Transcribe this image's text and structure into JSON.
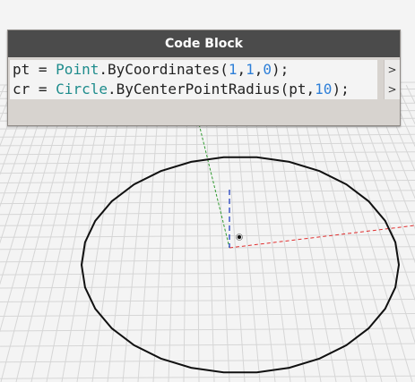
{
  "node": {
    "title": "Code Block",
    "lines": [
      {
        "var": "pt",
        "eq": " = ",
        "class_name": "Point",
        "method": ".ByCoordinates(",
        "args": [
          "1",
          "1",
          "0"
        ],
        "close": ");",
        "port": ">"
      },
      {
        "var": "cr",
        "eq": " = ",
        "class_name": "Circle",
        "method": ".ByCenterPointRadius(",
        "arg_ref": "pt",
        "arg_num": "10",
        "close": ");",
        "port": ">"
      }
    ]
  },
  "colors": {
    "background": "#f4f4f4",
    "grid": "#d6d6d6",
    "node_header": "#4b4b4b",
    "node_body": "#d7d3cf",
    "class_token": "#1e8c8c",
    "number_token": "#2d7fd8",
    "circle": "#111111",
    "x_axis": "#e03030",
    "y_axis": "#2f9a2f",
    "z_axis": "#2040c0"
  }
}
